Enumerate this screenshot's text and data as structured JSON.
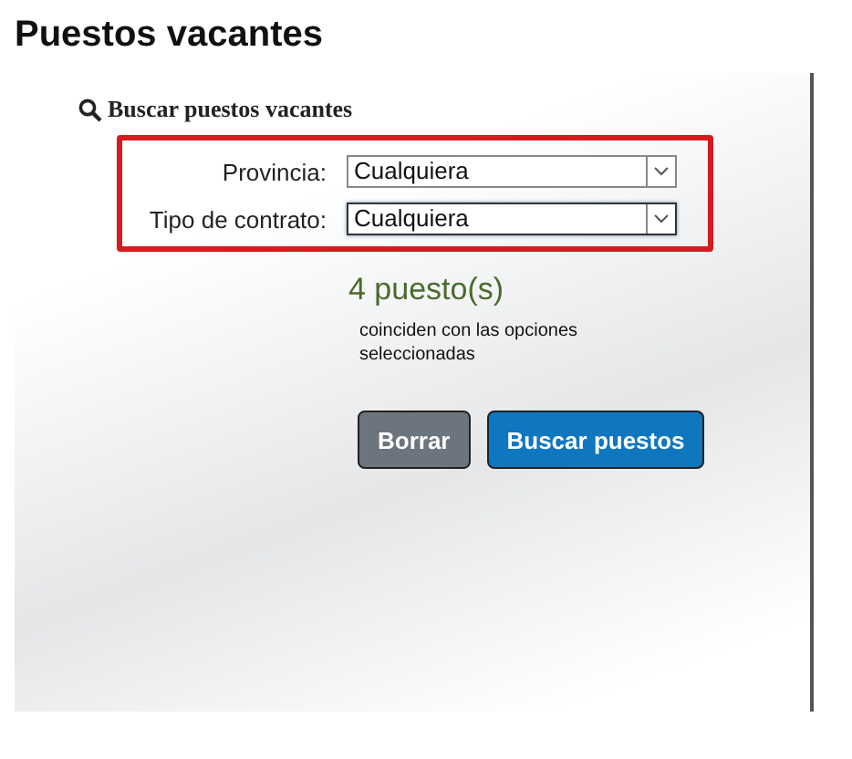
{
  "page_title": "Puestos vacantes",
  "search": {
    "title": "Buscar puestos vacantes",
    "fields": [
      {
        "label": "Provincia:",
        "value": "Cualquiera",
        "focused": false
      },
      {
        "label": "Tipo de contrato:",
        "value": "Cualquiera",
        "focused": true
      }
    ]
  },
  "result": {
    "count": "4 puesto(s)",
    "description": "coinciden con las opciones seleccionadas"
  },
  "buttons": [
    {
      "label": "Borrar",
      "kind": "secondary"
    },
    {
      "label": "Buscar puestos",
      "kind": "primary"
    }
  ]
}
